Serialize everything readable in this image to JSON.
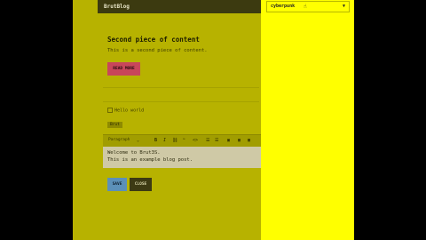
{
  "app": {
    "brand": "BrutBlog"
  },
  "post": {
    "title": "Second piece of content",
    "text": "This is a second piece of content.",
    "read_more": "READ MORE"
  },
  "form": {
    "checkbox_label": "Hello world",
    "tag_label": "Brut",
    "toolbar": {
      "paragraph": "Paragraph",
      "bold": "B",
      "italic": "I",
      "link": "⛓",
      "quote": "❝",
      "code": "<>",
      "list": "☰",
      "image": "▣",
      "table": "▦"
    },
    "editor_lines": [
      "Welcome to Brut3S.",
      "This is an example blog post."
    ],
    "save_label": "SAVE",
    "close_label": "CLOSE"
  },
  "theme": {
    "selected": "cyberpunk",
    "colors": {
      "main_bg": "#b7b200",
      "side_bg": "#ffff00",
      "accent": "#c8465a",
      "save": "#5c90b8"
    }
  }
}
